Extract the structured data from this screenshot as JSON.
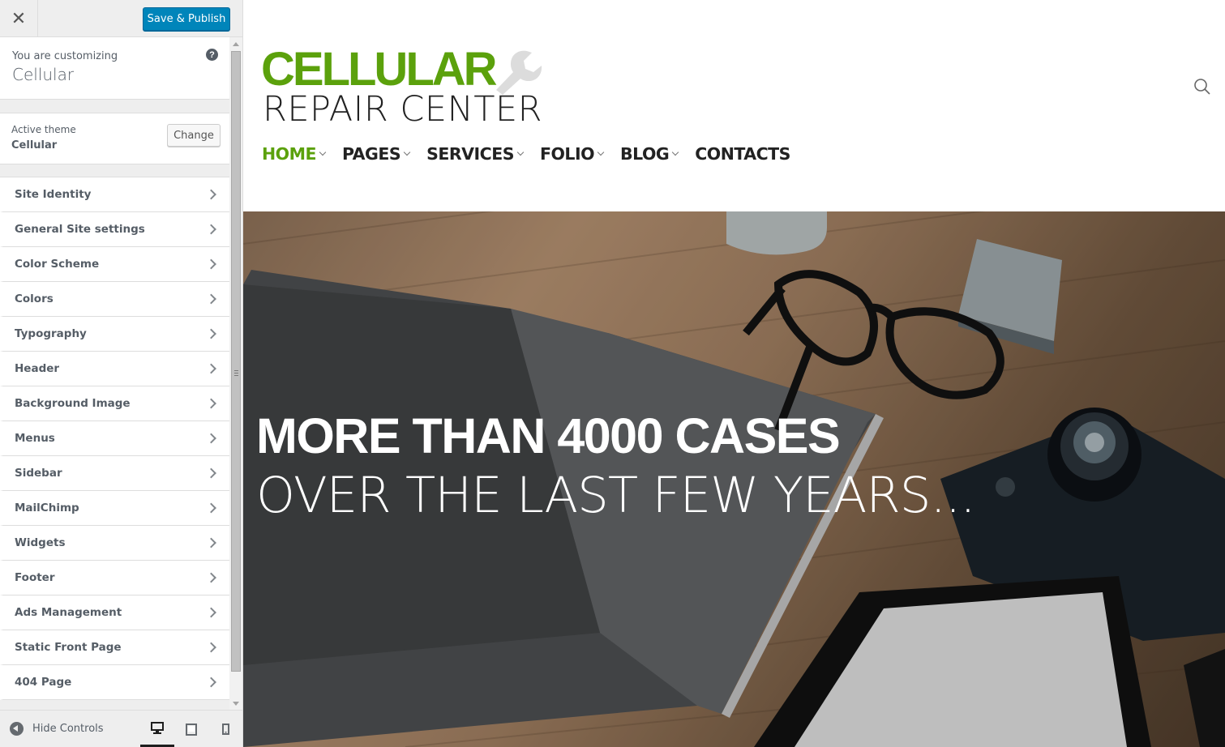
{
  "customizer": {
    "close_icon": "close-icon",
    "save_label": "Save & Publish",
    "info": {
      "customizing_label": "You are customizing",
      "site_name": "Cellular",
      "help_icon": "help-icon"
    },
    "theme": {
      "label": "Active theme",
      "name": "Cellular",
      "change_label": "Change"
    },
    "sections": [
      {
        "label": "Site Identity"
      },
      {
        "label": "General Site settings"
      },
      {
        "label": "Color Scheme"
      },
      {
        "label": "Colors"
      },
      {
        "label": "Typography"
      },
      {
        "label": "Header"
      },
      {
        "label": "Background Image"
      },
      {
        "label": "Menus"
      },
      {
        "label": "Sidebar"
      },
      {
        "label": "MailChimp"
      },
      {
        "label": "Widgets"
      },
      {
        "label": "Footer"
      },
      {
        "label": "Ads Management"
      },
      {
        "label": "Static Front Page"
      },
      {
        "label": "404 Page"
      }
    ],
    "footer": {
      "hide_label": "Hide Controls",
      "devices": [
        "desktop-icon",
        "tablet-icon",
        "mobile-icon"
      ],
      "active_device": "desktop"
    }
  },
  "preview": {
    "logo": {
      "top": "CELLULAR",
      "bottom": "REPAIR CENTER"
    },
    "nav": [
      {
        "label": "HOME",
        "active": true
      },
      {
        "label": "PAGES",
        "active": false
      },
      {
        "label": "SERVICES",
        "active": false
      },
      {
        "label": "FOLIO",
        "active": false
      },
      {
        "label": "BLOG",
        "active": false
      },
      {
        "label": "CONTACTS",
        "active": false
      }
    ],
    "hero": {
      "line1": "MORE THAN 4000 CASES",
      "line2": "OVER THE LAST FEW YEARS..."
    }
  },
  "colors": {
    "primary_button": "#0085ba",
    "brand_green": "#5ba10c",
    "panel_bg": "#eeeeee",
    "text": "#555d66"
  }
}
